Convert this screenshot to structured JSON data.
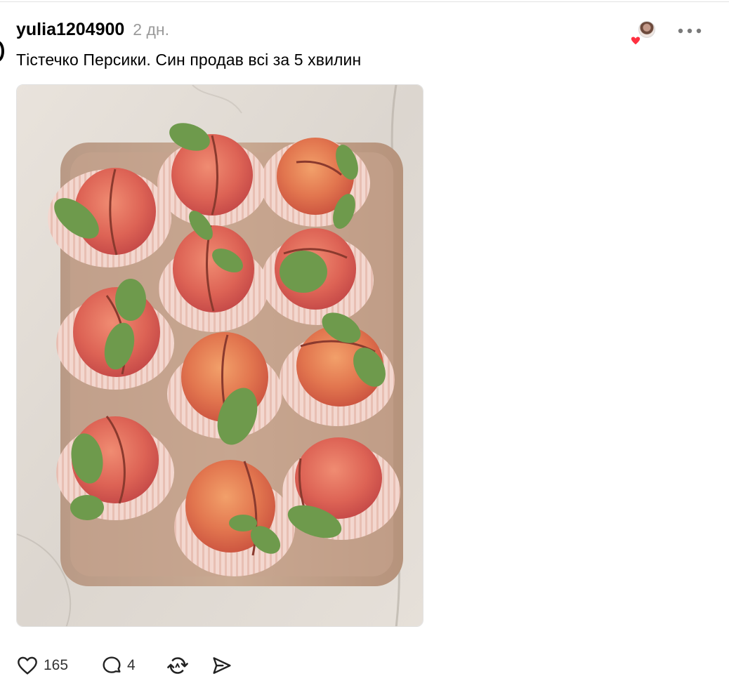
{
  "post": {
    "username": "yulia1204900",
    "time_ago": "2 дн.",
    "caption": "Тістечко Персики. Син продав всі за 5 хвилин",
    "likes": "165",
    "comments": "4"
  },
  "icons": {
    "like": "heart-outline-icon",
    "comment": "speech-bubble-icon",
    "repost": "repost-arrows-icon",
    "share": "send-icon",
    "more": "more-horizontal-icon",
    "liked_badge": "heart-filled-icon"
  },
  "colors": {
    "heart_badge": "#ff3040",
    "secondary_text": "#9a9a9a",
    "icon": "#222222"
  }
}
